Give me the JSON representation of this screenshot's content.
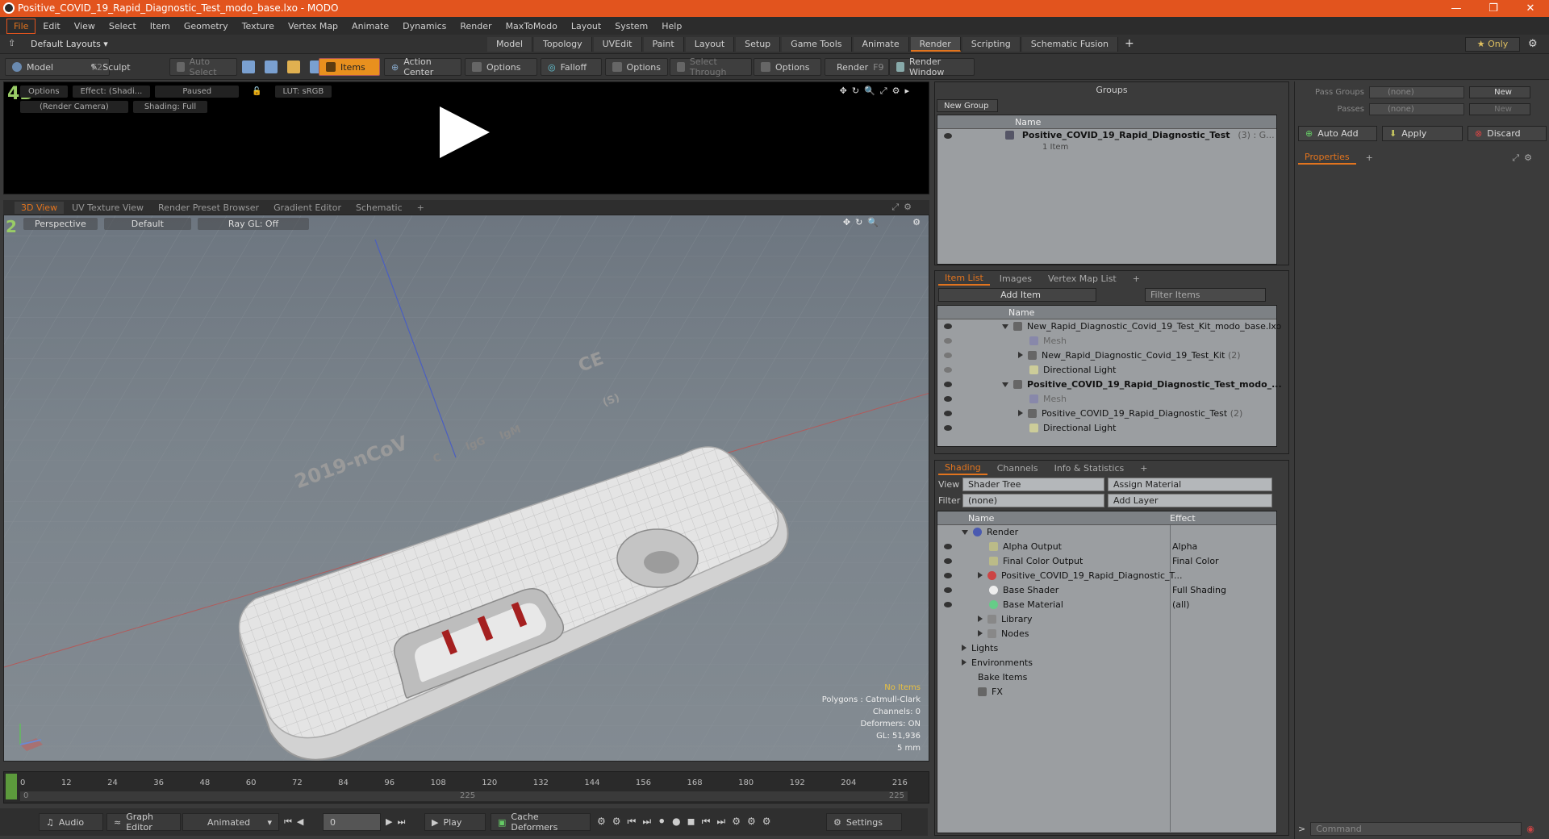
{
  "window": {
    "title": "Positive_COVID_19_Rapid_Diagnostic_Test_modo_base.lxo - MODO"
  },
  "menu": [
    "File",
    "Edit",
    "View",
    "Select",
    "Item",
    "Geometry",
    "Texture",
    "Vertex Map",
    "Animate",
    "Dynamics",
    "Render",
    "MaxToModo",
    "Layout",
    "System",
    "Help"
  ],
  "layout": {
    "selector": "Default Layouts ▾",
    "tabs": [
      "Model",
      "Topology",
      "UVEdit",
      "Paint",
      "Layout",
      "Setup",
      "Game Tools",
      "Animate",
      "Render",
      "Scripting",
      "Schematic Fusion"
    ],
    "active": "Render",
    "only": "★ Only"
  },
  "toolbar": {
    "model": "Model",
    "model_key": "F2",
    "sculpt": "Sculpt",
    "auto_select": "Auto Select",
    "items": "Items",
    "action_center": "Action Center",
    "options1": "Options",
    "falloff": "Falloff",
    "options2": "Options",
    "select_through": "Select Through",
    "options3": "Options",
    "render": "Render",
    "render_key": "F9",
    "render_window": "Render Window"
  },
  "render_preview": {
    "options": "Options",
    "effect": "Effect: (Shadi...",
    "paused": "Paused",
    "lut": "LUT: sRGB",
    "camera": "(Render Camera)",
    "shading": "Shading: Full"
  },
  "viewport_tabs": [
    "3D View",
    "UV Texture View",
    "Render Preset Browser",
    "Gradient Editor",
    "Schematic"
  ],
  "viewport": {
    "mode": "Perspective",
    "style": "Default",
    "raygl": "Ray GL: Off",
    "info": {
      "no_items": "No Items",
      "polygons": "Polygons : Catmull-Clark",
      "channels": "Channels: 0",
      "deformers": "Deformers: ON",
      "gl": "GL: 51,936",
      "scale": "5 mm"
    },
    "model_text": {
      "brand": "2019-nCoV",
      "c": "C",
      "igg": "IgG",
      "igm": "IgM",
      "ce": "CE",
      "s": "(S)"
    }
  },
  "timeline": {
    "ticks": [
      "0",
      "12",
      "24",
      "36",
      "48",
      "60",
      "72",
      "84",
      "96",
      "108",
      "120",
      "132",
      "144",
      "156",
      "168",
      "180",
      "192",
      "204",
      "216"
    ],
    "range_start": "0",
    "range_end": "225",
    "range_mid": "225"
  },
  "bottom": {
    "audio": "Audio",
    "graph_editor": "Graph Editor",
    "animated": "Animated",
    "frame": "0",
    "play": "Play",
    "cache_deformers": "Cache Deformers",
    "settings": "Settings"
  },
  "groups": {
    "title": "Groups",
    "new_group": "New Group",
    "col_name": "Name",
    "item": "Positive_COVID_19_Rapid_Diagnostic_Test",
    "item_suffix": "(3) : G...",
    "sub": "1 Item"
  },
  "itemlist": {
    "tabs": [
      "Item List",
      "Images",
      "Vertex Map List"
    ],
    "add_item": "Add Item",
    "filter": "Filter Items",
    "col_name": "Name",
    "rows": [
      {
        "label": "New_Rapid_Diagnostic_Covid_19_Test_Kit_modo_base.lxo",
        "indent": 0,
        "style": ""
      },
      {
        "label": "Mesh",
        "indent": 1,
        "style": "dim"
      },
      {
        "label": "New_Rapid_Diagnostic_Covid_19_Test_Kit",
        "count": "(2)",
        "indent": 1,
        "style": ""
      },
      {
        "label": "Directional Light",
        "indent": 1,
        "style": ""
      },
      {
        "label": "Positive_COVID_19_Rapid_Diagnostic_Test_modo_...",
        "indent": 0,
        "style": "bold"
      },
      {
        "label": "Mesh",
        "indent": 1,
        "style": "dim"
      },
      {
        "label": "Positive_COVID_19_Rapid_Diagnostic_Test",
        "count": "(2)",
        "indent": 1,
        "style": ""
      },
      {
        "label": "Directional Light",
        "indent": 1,
        "style": ""
      }
    ]
  },
  "shading": {
    "tabs": [
      "Shading",
      "Channels",
      "Info & Statistics"
    ],
    "view_label": "View",
    "view": "Shader Tree",
    "assign": "Assign Material",
    "filter_label": "Filter",
    "filter": "(none)",
    "add_layer": "Add Layer",
    "col_name": "Name",
    "col_effect": "Effect",
    "rows": [
      {
        "label": "Render",
        "effect": "",
        "indent": 0
      },
      {
        "label": "Alpha Output",
        "effect": "Alpha",
        "indent": 1
      },
      {
        "label": "Final Color Output",
        "effect": "Final Color",
        "indent": 1
      },
      {
        "label": "Positive_COVID_19_Rapid_Diagnostic_T...",
        "effect": "",
        "indent": 1
      },
      {
        "label": "Base Shader",
        "effect": "Full Shading",
        "indent": 1
      },
      {
        "label": "Base Material",
        "effect": "(all)",
        "indent": 1
      },
      {
        "label": "Library",
        "effect": "",
        "indent": 1
      },
      {
        "label": "Nodes",
        "effect": "",
        "indent": 1
      },
      {
        "label": "Lights",
        "effect": "",
        "indent": 0
      },
      {
        "label": "Environments",
        "effect": "",
        "indent": 0
      },
      {
        "label": "Bake Items",
        "effect": "",
        "indent": 0
      },
      {
        "label": "FX",
        "effect": "",
        "indent": 0
      }
    ]
  },
  "right": {
    "pass_groups": "Pass Groups",
    "passes": "Passes",
    "none": "(none)",
    "new": "New",
    "auto_add": "Auto Add",
    "apply": "Apply",
    "discard": "Discard",
    "properties": "Properties",
    "command": "Command"
  },
  "colors": {
    "accent": "#e2541e",
    "highlight": "#e8901e"
  }
}
